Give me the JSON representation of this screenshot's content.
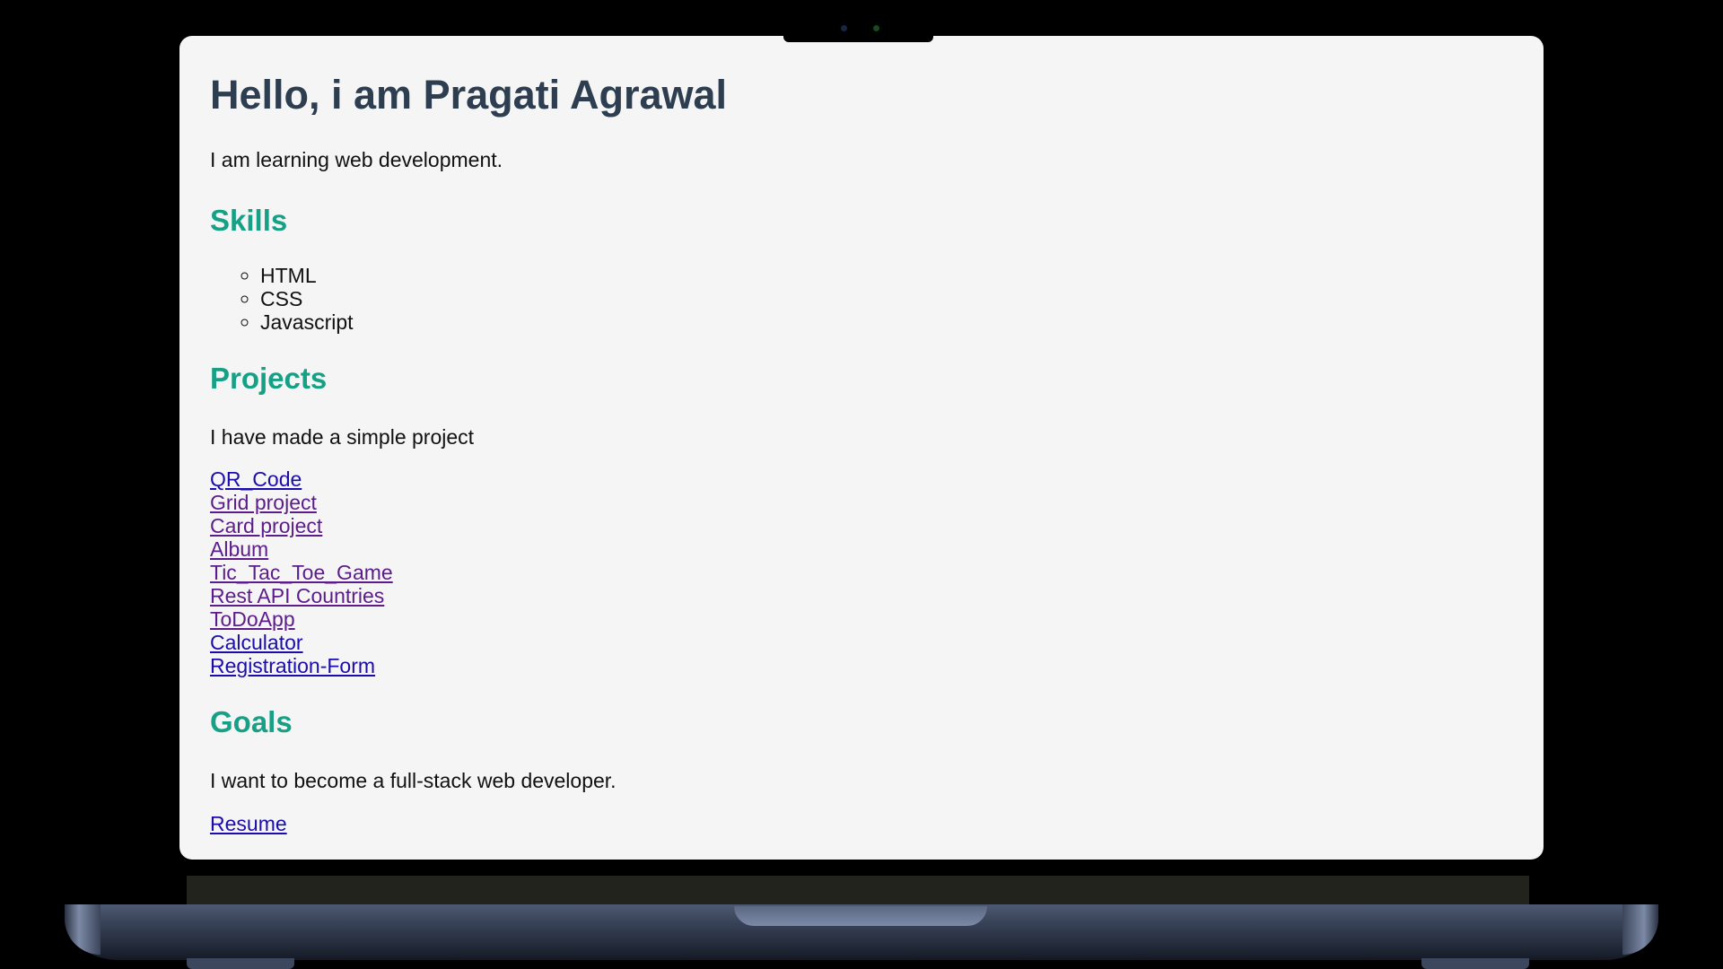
{
  "page": {
    "heading": "Hello, i am Pragati Agrawal",
    "intro": "I am learning web development."
  },
  "skills": {
    "title": "Skills",
    "items": [
      "HTML",
      "CSS",
      "Javascript"
    ]
  },
  "projects": {
    "title": "Projects",
    "text": "I have made a simple project",
    "links": [
      {
        "label": "QR_Code",
        "visited": false
      },
      {
        "label": "Grid project",
        "visited": true
      },
      {
        "label": "Card project",
        "visited": true
      },
      {
        "label": "Album",
        "visited": true
      },
      {
        "label": "Tic_Tac_Toe_Game",
        "visited": true
      },
      {
        "label": "Rest API Countries",
        "visited": true
      },
      {
        "label": "ToDoApp",
        "visited": true
      },
      {
        "label": "Calculator",
        "visited": false
      },
      {
        "label": "Registration-Form",
        "visited": false
      }
    ]
  },
  "goals": {
    "title": "Goals",
    "text": "I want to become a full-stack web developer."
  },
  "resume": {
    "label": "Resume"
  },
  "colors": {
    "heading": "#2c3e50",
    "section_title": "#16a085",
    "link": "#1a0dab",
    "link_visited": "#5c1d8a",
    "page_background": "#f5f5f5"
  }
}
